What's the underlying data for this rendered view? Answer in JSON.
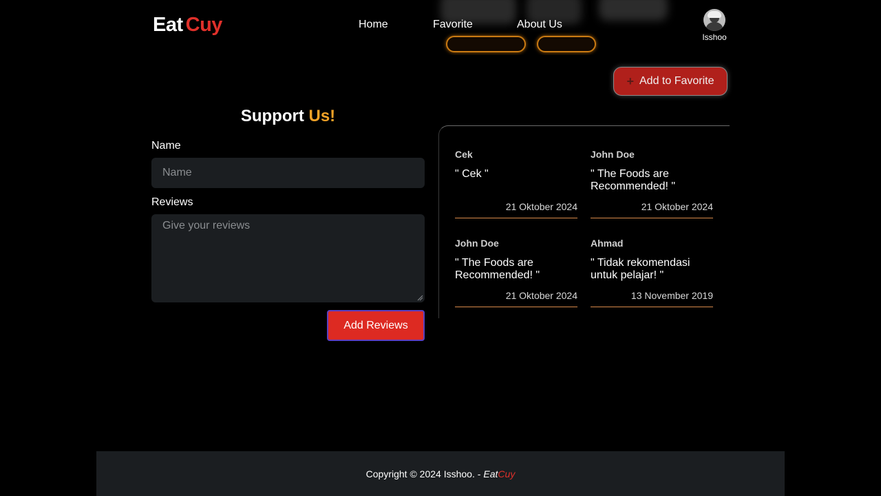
{
  "header": {
    "logo_primary": "Eat",
    "logo_accent": "Cuy",
    "nav": [
      {
        "label": "Home"
      },
      {
        "label": "Favorite"
      },
      {
        "label": "About Us"
      }
    ],
    "user": {
      "name": "Isshoo",
      "avatar_icon": "user-avatar-icon"
    }
  },
  "favorite_button": {
    "label": "Add to Favorite",
    "icon": "plus-icon"
  },
  "support_form": {
    "title_primary": "Support",
    "title_accent": "Us!",
    "name_label": "Name",
    "name_placeholder": "Name",
    "name_value": "",
    "reviews_label": "Reviews",
    "reviews_placeholder": "Give your reviews",
    "reviews_value": "",
    "submit_label": "Add Reviews"
  },
  "reviews": [
    {
      "author": "Cek",
      "text": "\" Cek \"",
      "date": "21 Oktober 2024"
    },
    {
      "author": "John Doe",
      "text": "\" The Foods are Recommended! \"",
      "date": "21 Oktober 2024"
    },
    {
      "author": "John Doe",
      "text": "\" The Foods are Recommended! \"",
      "date": "21 Oktober 2024"
    },
    {
      "author": "Ahmad",
      "text": "\" Tidak rekomendasi untuk pelajar! \"",
      "date": "13 November 2019"
    }
  ],
  "footer": {
    "copyright": "Copyright © 2024 Isshoo. -",
    "brand_primary": "Eat",
    "brand_accent": "Cuy"
  },
  "colors": {
    "accent_red": "#e0302a",
    "accent_orange": "#f2a227",
    "background": "#000000",
    "panel": "#1b1e21"
  }
}
